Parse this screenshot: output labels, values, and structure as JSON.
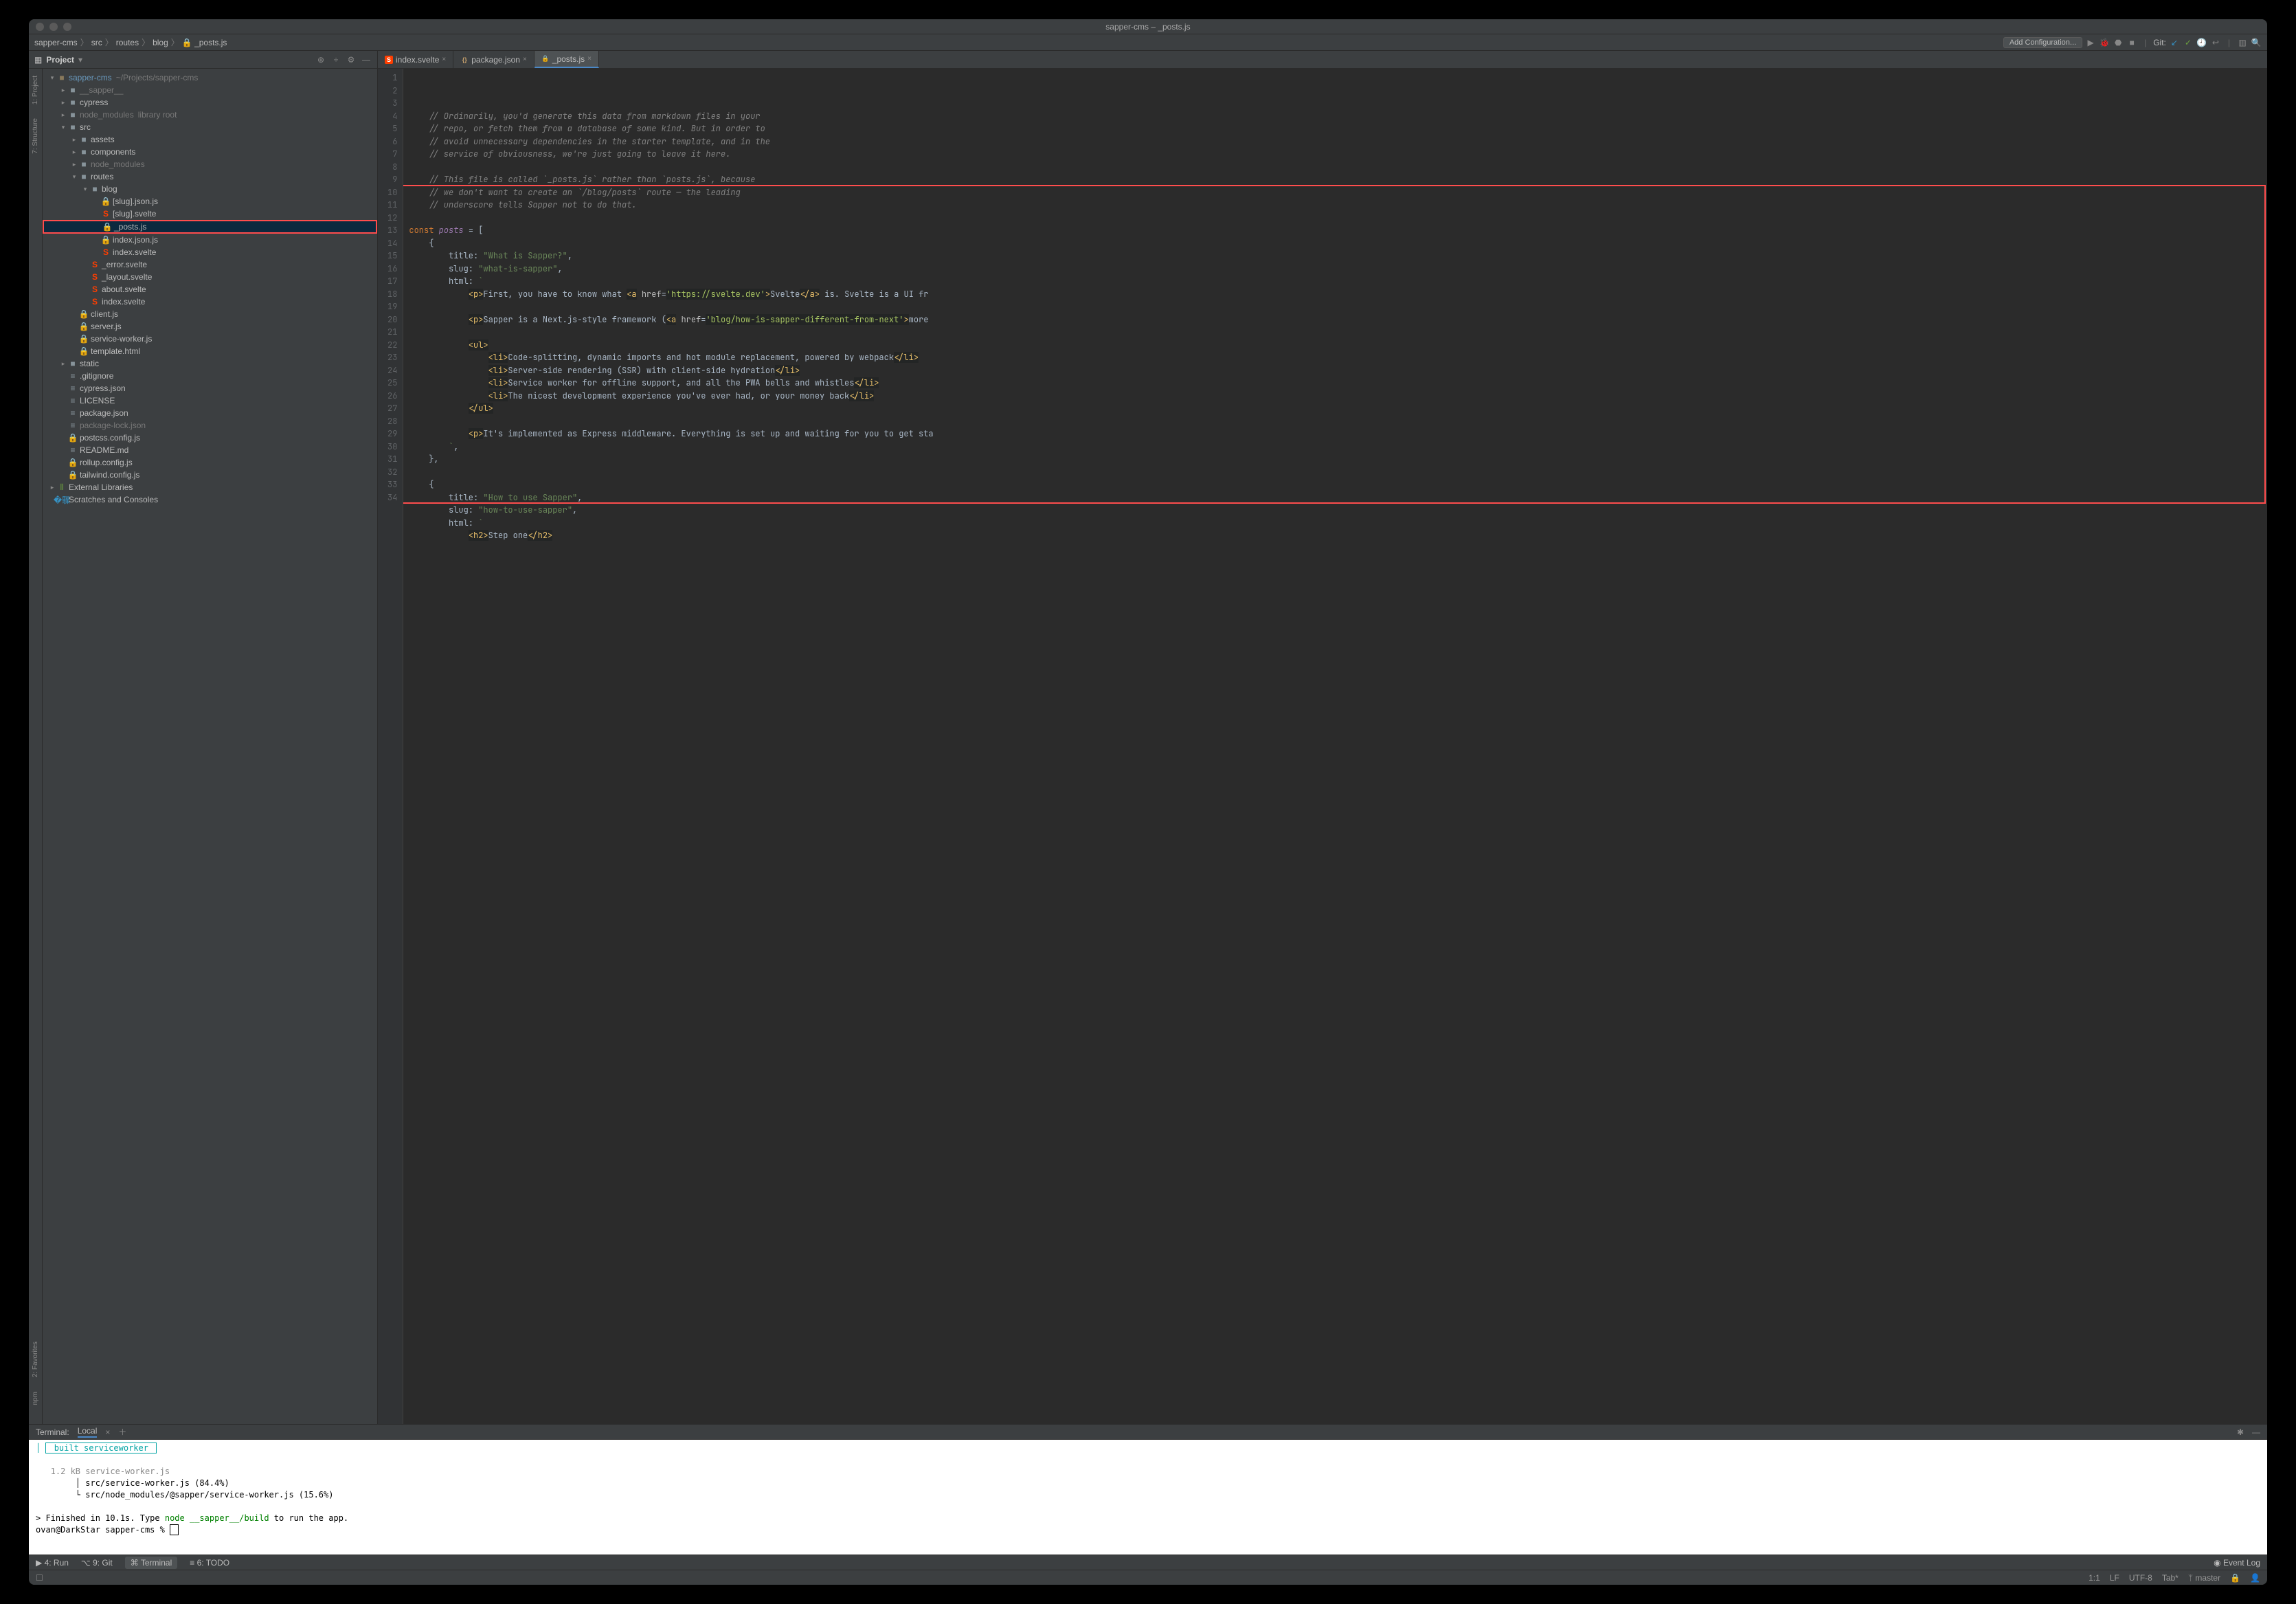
{
  "window_title": "sapper-cms – _posts.js",
  "breadcrumbs": [
    "sapper-cms",
    "src",
    "routes",
    "blog",
    "_posts.js"
  ],
  "run_config_button": "Add Configuration...",
  "git_label": "Git:",
  "project_tool_label": "Project",
  "siderail_left": [
    "1: Project",
    "7: Structure"
  ],
  "siderail_left_bottom": [
    "2: Favorites",
    "npm"
  ],
  "editor_tabs": [
    {
      "name": "index.svelte",
      "icon": "sv",
      "active": false
    },
    {
      "name": "package.json",
      "icon": "json",
      "active": false
    },
    {
      "name": "_posts.js",
      "icon": "lock",
      "active": true
    }
  ],
  "tree": [
    {
      "d": 0,
      "arrow": "open",
      "icon": "folder root",
      "label": "sapper-cms",
      "hint": "~/Projects/sapper-cms",
      "mod": true
    },
    {
      "d": 1,
      "arrow": "closed",
      "icon": "folder",
      "label": "__sapper__",
      "dim": true
    },
    {
      "d": 1,
      "arrow": "closed",
      "icon": "folder",
      "label": "cypress"
    },
    {
      "d": 1,
      "arrow": "closed",
      "icon": "folder",
      "label": "node_modules",
      "hint": "library root",
      "dim": true
    },
    {
      "d": 1,
      "arrow": "open",
      "icon": "folder",
      "label": "src"
    },
    {
      "d": 2,
      "arrow": "closed",
      "icon": "folder",
      "label": "assets"
    },
    {
      "d": 2,
      "arrow": "closed",
      "icon": "folder",
      "label": "components"
    },
    {
      "d": 2,
      "arrow": "closed",
      "icon": "folder",
      "label": "node_modules",
      "dim": true
    },
    {
      "d": 2,
      "arrow": "open",
      "icon": "folder",
      "label": "routes"
    },
    {
      "d": 3,
      "arrow": "open",
      "icon": "folder",
      "label": "blog"
    },
    {
      "d": 4,
      "arrow": "none",
      "icon": "js",
      "label": "[slug].json.js"
    },
    {
      "d": 4,
      "arrow": "none",
      "icon": "svelte",
      "label": "[slug].svelte"
    },
    {
      "d": 4,
      "arrow": "none",
      "icon": "js",
      "label": "_posts.js",
      "selected": true,
      "highlight": true
    },
    {
      "d": 4,
      "arrow": "none",
      "icon": "js",
      "label": "index.json.js"
    },
    {
      "d": 4,
      "arrow": "none",
      "icon": "svelte",
      "label": "index.svelte"
    },
    {
      "d": 3,
      "arrow": "none",
      "icon": "svelte",
      "label": "_error.svelte"
    },
    {
      "d": 3,
      "arrow": "none",
      "icon": "svelte",
      "label": "_layout.svelte"
    },
    {
      "d": 3,
      "arrow": "none",
      "icon": "svelte",
      "label": "about.svelte"
    },
    {
      "d": 3,
      "arrow": "none",
      "icon": "svelte",
      "label": "index.svelte"
    },
    {
      "d": 2,
      "arrow": "none",
      "icon": "js",
      "label": "client.js"
    },
    {
      "d": 2,
      "arrow": "none",
      "icon": "js",
      "label": "server.js"
    },
    {
      "d": 2,
      "arrow": "none",
      "icon": "js",
      "label": "service-worker.js"
    },
    {
      "d": 2,
      "arrow": "none",
      "icon": "js",
      "label": "template.html"
    },
    {
      "d": 1,
      "arrow": "closed",
      "icon": "folder",
      "label": "static"
    },
    {
      "d": 1,
      "arrow": "none",
      "icon": "file",
      "label": ".gitignore"
    },
    {
      "d": 1,
      "arrow": "none",
      "icon": "file",
      "label": "cypress.json"
    },
    {
      "d": 1,
      "arrow": "none",
      "icon": "file",
      "label": "LICENSE"
    },
    {
      "d": 1,
      "arrow": "none",
      "icon": "file",
      "label": "package.json"
    },
    {
      "d": 1,
      "arrow": "none",
      "icon": "file",
      "label": "package-lock.json",
      "dim": true
    },
    {
      "d": 1,
      "arrow": "none",
      "icon": "js",
      "label": "postcss.config.js"
    },
    {
      "d": 1,
      "arrow": "none",
      "icon": "file",
      "label": "README.md"
    },
    {
      "d": 1,
      "arrow": "none",
      "icon": "js",
      "label": "rollup.config.js"
    },
    {
      "d": 1,
      "arrow": "none",
      "icon": "js",
      "label": "tailwind.config.js"
    },
    {
      "d": 0,
      "arrow": "closed",
      "icon": "lib",
      "label": "External Libraries"
    },
    {
      "d": 0,
      "arrow": "none",
      "icon": "scratch",
      "label": "Scratches and Consoles"
    }
  ],
  "code_lines": [
    {
      "n": 1,
      "t": "comment",
      "s": "    // Ordinarily, you'd generate this data from markdown files in your"
    },
    {
      "n": 2,
      "t": "comment",
      "s": "    // repo, or fetch them from a database of some kind. But in order to"
    },
    {
      "n": 3,
      "t": "comment",
      "s": "    // avoid unnecessary dependencies in the starter template, and in the"
    },
    {
      "n": 4,
      "t": "comment",
      "s": "    // service of obviousness, we're just going to leave it here."
    },
    {
      "n": 5,
      "t": "blank",
      "s": ""
    },
    {
      "n": 6,
      "t": "comment",
      "s": "    // This file is called `_posts.js` rather than `posts.js`, because"
    },
    {
      "n": 7,
      "t": "comment",
      "s": "    // we don't want to create an `/blog/posts` route — the leading"
    },
    {
      "n": 8,
      "t": "comment",
      "s": "    // underscore tells Sapper not to do that."
    },
    {
      "n": 9,
      "t": "blank",
      "s": ""
    },
    {
      "n": 10,
      "t": "code",
      "html": "<span class='c-kw'>const</span> <span class='c-var'>posts</span> = ["
    },
    {
      "n": 11,
      "t": "code",
      "html": "    {"
    },
    {
      "n": 12,
      "t": "code",
      "html": "        title: <span class='c-str'>\"What is Sapper?\"</span>,"
    },
    {
      "n": 13,
      "t": "code",
      "html": "        slug: <span class='c-str'>\"what-is-sapper\"</span>,"
    },
    {
      "n": 14,
      "t": "code",
      "html": "        html: <span class='c-str'>`</span>"
    },
    {
      "n": 15,
      "t": "code",
      "html": "            <span class='c-tag'>&lt;p&gt;</span>First, you have to know what <span class='c-tag'>&lt;a</span> <span class='c-attr'>href</span>=<span class='c-aval'>'https://svelte.dev'</span><span class='c-tag'>&gt;</span>Svelte<span class='c-tag'>&lt;/a&gt;</span> is. Svelte is a UI fr"
    },
    {
      "n": 16,
      "t": "blank",
      "s": ""
    },
    {
      "n": 17,
      "t": "code",
      "html": "            <span class='c-tag'>&lt;p&gt;</span>Sapper is a Next.js-style framework (<span class='c-tag'>&lt;a</span> <span class='c-attr'>href</span>=<span class='c-aval'>'blog/how-is-sapper-different-from-next'</span><span class='c-tag'>&gt;</span>more"
    },
    {
      "n": 18,
      "t": "blank",
      "s": ""
    },
    {
      "n": 19,
      "t": "code",
      "html": "            <span class='c-tag'>&lt;ul&gt;</span>"
    },
    {
      "n": 20,
      "t": "code",
      "html": "                <span class='c-tag'>&lt;li&gt;</span>Code-splitting, dynamic imports and hot module replacement, powered by webpack<span class='c-tag'>&lt;/li&gt;</span>"
    },
    {
      "n": 21,
      "t": "code",
      "html": "                <span class='c-tag'>&lt;li&gt;</span>Server-side rendering (SSR) with client-side hydration<span class='c-tag'>&lt;/li&gt;</span>"
    },
    {
      "n": 22,
      "t": "code",
      "html": "                <span class='c-tag'>&lt;li&gt;</span>Service worker for offline support, and all the PWA bells and whistles<span class='c-tag'>&lt;/li&gt;</span>"
    },
    {
      "n": 23,
      "t": "code",
      "html": "                <span class='c-tag'>&lt;li&gt;</span>The nicest development experience you've ever had, or your money back<span class='c-tag'>&lt;/li&gt;</span>"
    },
    {
      "n": 24,
      "t": "code",
      "html": "            <span class='c-tag'>&lt;/ul&gt;</span>"
    },
    {
      "n": 25,
      "t": "blank",
      "s": ""
    },
    {
      "n": 26,
      "t": "code",
      "html": "            <span class='c-tag'>&lt;p&gt;</span>It's implemented as Express middleware. Everything is set up and waiting for you to get sta"
    },
    {
      "n": 27,
      "t": "code",
      "html": "        <span class='c-str'>`</span>,"
    },
    {
      "n": 28,
      "t": "code",
      "html": "    },"
    },
    {
      "n": 29,
      "t": "blank",
      "s": ""
    },
    {
      "n": 30,
      "t": "code",
      "html": "    {"
    },
    {
      "n": 31,
      "t": "code",
      "html": "        title: <span class='c-str'>\"How to use Sapper\"</span>,"
    },
    {
      "n": 32,
      "t": "code",
      "html": "        slug: <span class='c-str'>\"how-to-use-sapper\"</span>,"
    },
    {
      "n": 33,
      "t": "code",
      "html": "        html: <span class='c-str'>`</span>"
    },
    {
      "n": 34,
      "t": "code",
      "html": "            <span class='c-tag'>&lt;h2&gt;</span>Step one<span class='c-tag'>&lt;/h2&gt;</span>"
    }
  ],
  "terminal": {
    "header_label": "Terminal:",
    "tab": "Local",
    "lines": [
      {
        "cls": "boxed",
        "s": " built serviceworker "
      },
      {
        "cls": "",
        "s": ""
      },
      {
        "cls": "dim",
        "s": "   1.2 kB service-worker.js"
      },
      {
        "cls": "",
        "s": "        │ src/service-worker.js (84.4%)"
      },
      {
        "cls": "",
        "s": "        └ src/node_modules/@sapper/service-worker.js (15.6%)"
      },
      {
        "cls": "",
        "s": ""
      }
    ],
    "prompt_prefix": "> Finished in 10.1s. Type ",
    "prompt_cmd": "node __sapper__/build",
    "prompt_suffix": " to run the app.",
    "shell_prompt": "ovan@DarkStar sapper-cms % "
  },
  "toolstrip": {
    "items": [
      "▶ 4: Run",
      "⌥ 9: Git",
      "⌘ Terminal",
      "≡ 6: TODO"
    ],
    "active_idx": 2,
    "event_log": "Event Log"
  },
  "statusbar": {
    "pos": "1:1",
    "lf": "LF",
    "enc": "UTF-8",
    "indent": "Tab*",
    "branch": "master"
  }
}
